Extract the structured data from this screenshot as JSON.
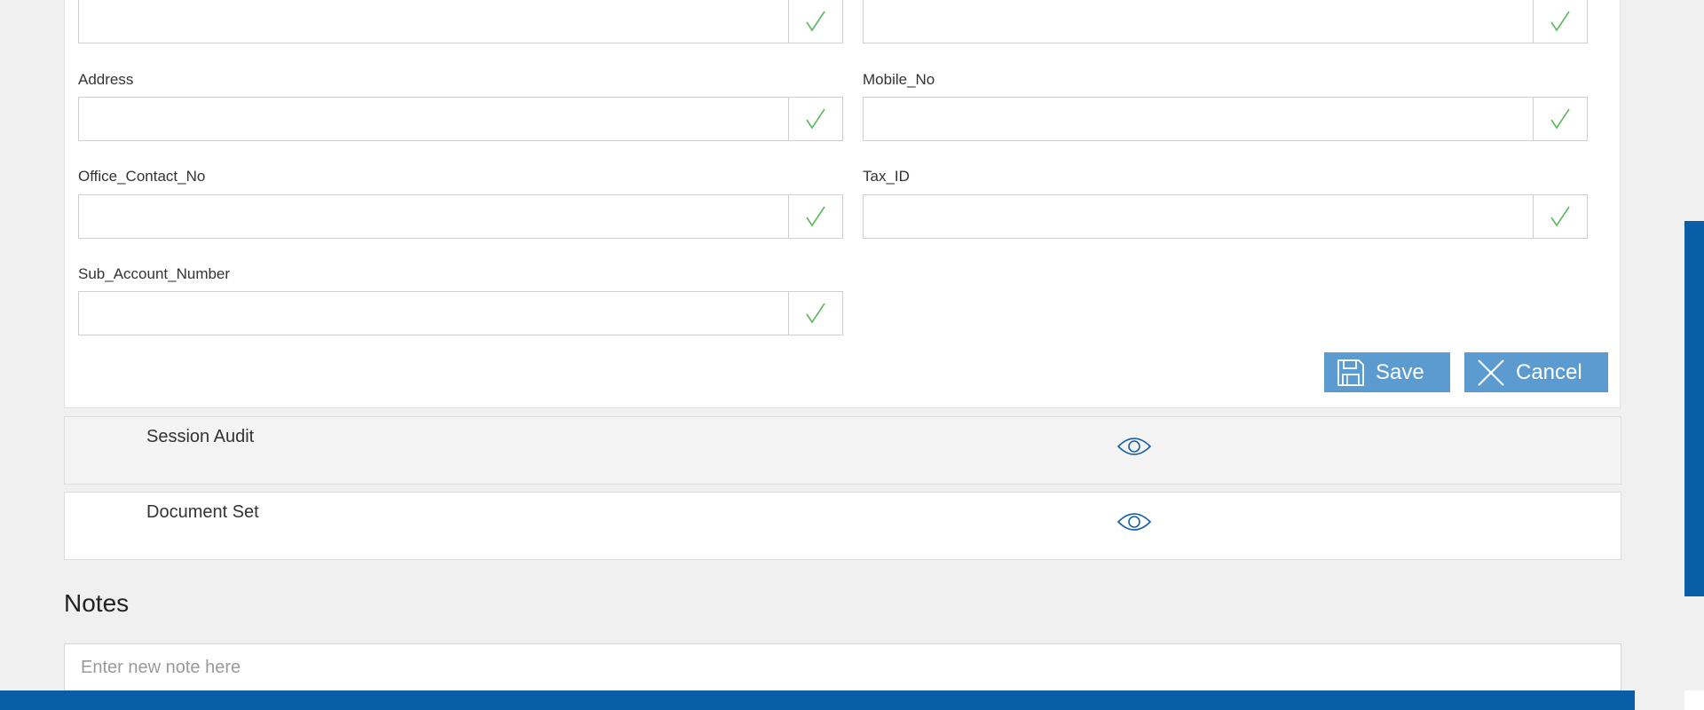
{
  "form": {
    "fields": [
      {
        "label": "",
        "value": ""
      },
      {
        "label": "",
        "value": ""
      },
      {
        "label": "Address",
        "value": ""
      },
      {
        "label": "Mobile_No",
        "value": ""
      },
      {
        "label": "Office_Contact_No",
        "value": ""
      },
      {
        "label": "Tax_ID",
        "value": ""
      },
      {
        "label": "Sub_Account_Number",
        "value": ""
      }
    ],
    "valid_icon": "check-icon",
    "valid_color": "#5cb85c",
    "save_label": "Save",
    "cancel_label": "Cancel"
  },
  "sections": [
    {
      "label": "Session Audit",
      "icon": "eye-icon"
    },
    {
      "label": "Document Set",
      "icon": "eye-icon"
    }
  ],
  "notes": {
    "title": "Notes",
    "placeholder": "Enter new note here"
  },
  "colors": {
    "accent": "#0a5ea8",
    "button": "#5b9bcf",
    "background": "#f0f0f0"
  }
}
